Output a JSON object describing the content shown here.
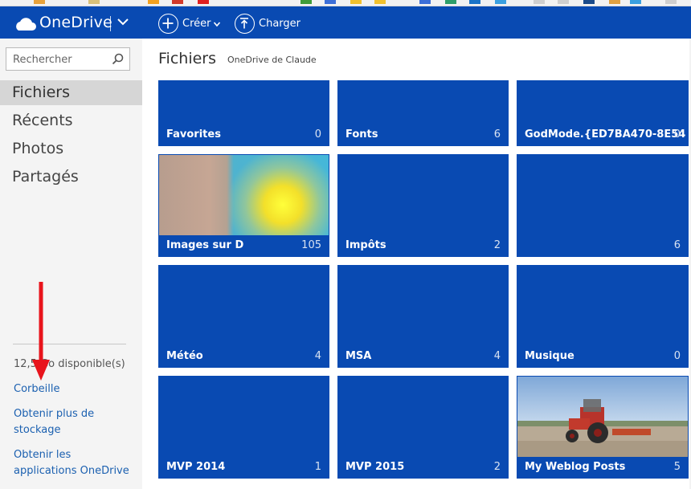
{
  "colors": {
    "topbar": "#094ab2",
    "tile": "#094ab2",
    "link": "#1b60b0",
    "sidebar": "#f4f4f4",
    "arrow": "#e8141c"
  },
  "topbar": {
    "brand": "OneDrive",
    "create_label": "Créer",
    "upload_label": "Charger",
    "icons": [
      "cloud-icon",
      "chevron-down-icon",
      "plus-icon",
      "upload-icon"
    ]
  },
  "sidebar": {
    "search_placeholder": "Rechercher",
    "nav": [
      {
        "label": "Fichiers",
        "selected": true
      },
      {
        "label": "Récents",
        "selected": false
      },
      {
        "label": "Photos",
        "selected": false
      },
      {
        "label": "Partagés",
        "selected": false
      }
    ],
    "storage_text": "12,5 Go disponible(s)",
    "links": {
      "recycle": "Corbeille",
      "more_storage": "Obtenir plus de stockage",
      "get_apps": "Obtenir les applications OneDrive"
    }
  },
  "main": {
    "title": "Fichiers",
    "subtitle": "OneDrive de Claude",
    "tiles": [
      {
        "name": "Favorites",
        "count": "0"
      },
      {
        "name": "Fonts",
        "count": "6"
      },
      {
        "name": "GodMode.{ED7BA470-8E54",
        "count": "0"
      },
      {
        "name": "Images sur D",
        "count": "105"
      },
      {
        "name": "Impôts",
        "count": "2"
      },
      {
        "name": "",
        "count": "6"
      },
      {
        "name": "Météo",
        "count": "4"
      },
      {
        "name": "MSA",
        "count": "4"
      },
      {
        "name": "Musique",
        "count": "0"
      },
      {
        "name": "MVP 2014",
        "count": "1"
      },
      {
        "name": "MVP 2015",
        "count": "2"
      },
      {
        "name": "My Weblog Posts",
        "count": "5"
      }
    ]
  }
}
